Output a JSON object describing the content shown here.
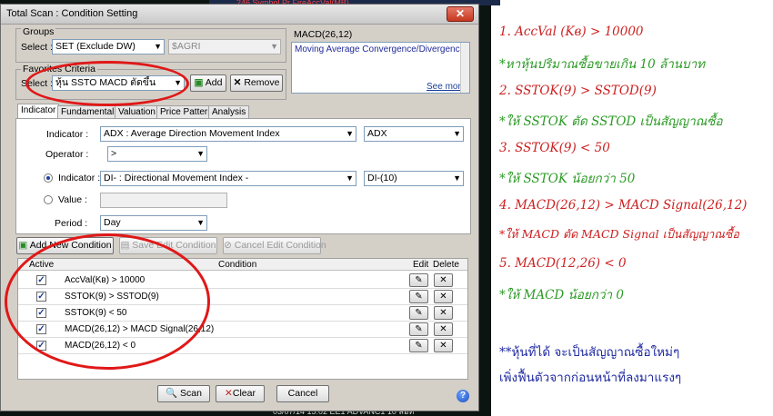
{
  "background": {
    "top_strip": "246   Symbol   Pr   FireAccVal(MB)",
    "bottom_strip": "03/07/14 15:02  EE1  ADVANC1  10 ลอท"
  },
  "window": {
    "title": "Total Scan : Condition Setting",
    "close_glyph": "✕"
  },
  "groups": {
    "label": "Groups",
    "select_label": "Select :",
    "select_value": "SET (Exclude DW)",
    "secondary_value": "$AGRI"
  },
  "description": {
    "title": "MACD(26,12)",
    "text": "Moving Average Convergence/Divergence",
    "see_more": "See more"
  },
  "favorites": {
    "label": "Favorites Criteria",
    "select_label": "Select :",
    "select_value": "หุ้น SSTO MACD ตัดขึ้น",
    "add_label": "Add",
    "remove_label": "Remove"
  },
  "tabs": [
    "Indicator",
    "Fundamental",
    "Valuation",
    "Price Pattern",
    "Analysis"
  ],
  "indicator": {
    "indicator_label": "Indicator :",
    "indicator_value": "ADX : Average Direction Movement Index",
    "indicator_short": "ADX",
    "operator_label": "Operator :",
    "operator_value": ">",
    "indicator2_label": "Indicator :",
    "indicator2_value": "DI- : Directional Movement Index -",
    "indicator2_short": "DI-(10)",
    "value_label": "Value :",
    "period_label": "Period :",
    "period_value": "Day"
  },
  "actions": {
    "add": "Add New Condition",
    "save": "Save Edit Condition",
    "cancel_edit": "Cancel Edit Condition"
  },
  "grid": {
    "headers": {
      "active": "Active",
      "condition": "Condition",
      "edit": "Edit",
      "delete": "Delete"
    },
    "rows": [
      {
        "condition": "AccVal(Kв) > 10000"
      },
      {
        "condition": "SSTOK(9) > SSTOD(9)"
      },
      {
        "condition": "SSTOK(9) < 50"
      },
      {
        "condition": "MACD(26,12) > MACD Signal(26,12)"
      },
      {
        "condition": "MACD(26,12) < 0"
      }
    ]
  },
  "footer": {
    "scan": "Scan",
    "clear": "Clear",
    "cancel": "Cancel",
    "help": "?"
  },
  "annotations": [
    {
      "text": "1. AccVal (Kв) > 10000",
      "color": "red"
    },
    {
      "text": "*หาหุ้นปริมาณซื้อขายเกิน 10 ล้านบาท",
      "color": "green"
    },
    {
      "text": "2. SSTOK(9) > SSTOD(9)",
      "color": "red"
    },
    {
      "text": "*ให้ SSTOK ตัด SSTOD เป็นสัญญาณซื้อ",
      "color": "green"
    },
    {
      "text": "3. SSTOK(9) < 50",
      "color": "red"
    },
    {
      "text": "*ให้ SSTOK น้อยกว่า 50",
      "color": "green"
    },
    {
      "text": "4. MACD(26,12) > MACD Signal(26,12)",
      "color": "red"
    },
    {
      "text": "*ให้ MACD ตัด MACD Signal เป็นสัญญาณซื้อ",
      "color": "red"
    },
    {
      "text": "5. MACD(12,26) < 0",
      "color": "red"
    },
    {
      "text": "*ให้ MACD น้อยกว่า 0",
      "color": "green"
    },
    {
      "text": "**หุ้นที่ได้ จะเป็นสัญญาณซื้อใหม่ๆ",
      "color": "dark"
    },
    {
      "text": "เพิ่งฟื้นตัวจากก่อนหน้าที่ลงมาแรงๆ",
      "color": "dark"
    }
  ],
  "colors": {
    "annotation_red": "#cc1f1f",
    "annotation_green": "#2a9a24",
    "annotation_dark": "#1f2aa0",
    "highlight_circle": "#e01818"
  }
}
